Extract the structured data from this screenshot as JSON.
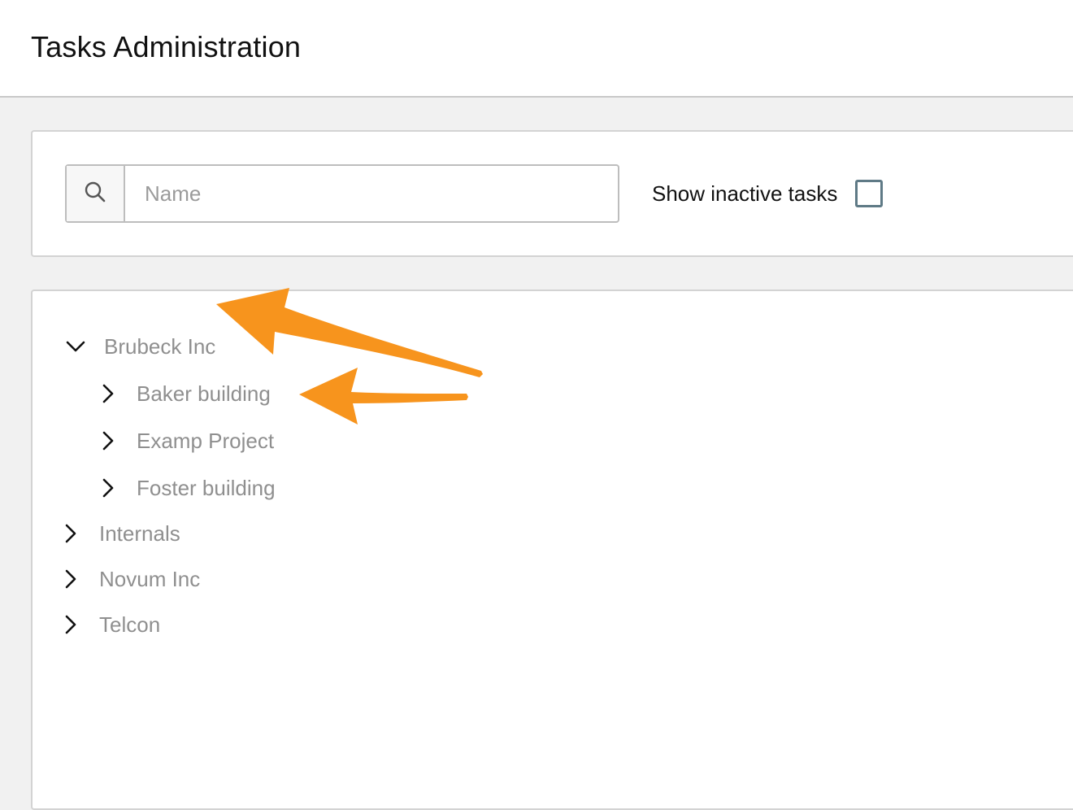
{
  "header": {
    "title": "Tasks Administration"
  },
  "filter": {
    "search_placeholder": "Name",
    "search_value": "",
    "show_inactive_label": "Show inactive tasks",
    "show_inactive_checked": false
  },
  "tree": {
    "items": [
      {
        "label": "Brubeck Inc",
        "expanded": true,
        "level": 0
      },
      {
        "label": "Baker building",
        "expanded": false,
        "level": 1
      },
      {
        "label": "Examp Project",
        "expanded": false,
        "level": 1
      },
      {
        "label": "Foster building",
        "expanded": false,
        "level": 1
      },
      {
        "label": "Internals",
        "expanded": false,
        "level": 0
      },
      {
        "label": "Novum Inc",
        "expanded": false,
        "level": 0
      },
      {
        "label": "Telcon",
        "expanded": false,
        "level": 0
      }
    ]
  },
  "icons": {
    "search": "search-icon",
    "expanded": "chevron-down-icon",
    "collapsed": "chevron-right-icon"
  },
  "colors": {
    "annotation_arrow": "#f7941d",
    "checkbox_border": "#5f7a86",
    "tree_label": "#8f8f8f"
  }
}
